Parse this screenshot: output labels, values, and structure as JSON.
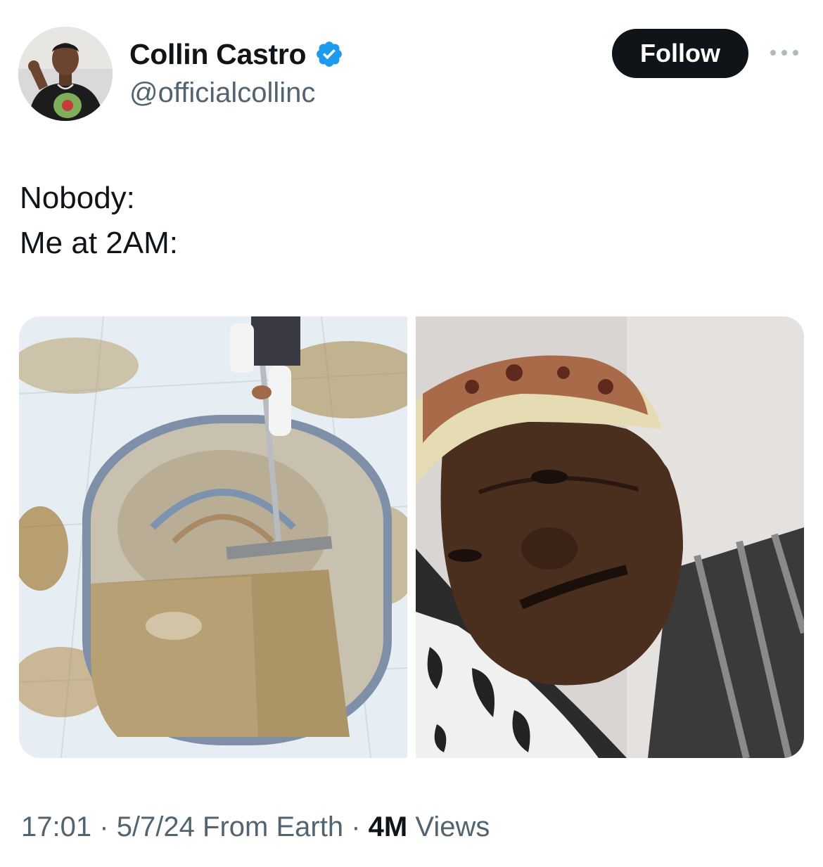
{
  "author": {
    "display_name": "Collin Castro",
    "handle": "@officialcollinc",
    "verified": true,
    "avatar_icon": "profile-photo"
  },
  "follow_label": "Follow",
  "more_icon": "more-options-icon",
  "tweet": {
    "lines": [
      "Nobody:",
      "Me at 2AM:"
    ]
  },
  "media": [
    {
      "icon": "photo-rug-cleaning"
    },
    {
      "icon": "photo-man-lying-down"
    }
  ],
  "meta": {
    "time": "17:01",
    "date": "5/7/24",
    "location": "From Earth",
    "views_count": "4M",
    "views_label": "Views",
    "separator": "·"
  },
  "colors": {
    "verified_blue": "#1d9bf0",
    "button_bg": "#0f1419",
    "secondary_text": "#536471"
  }
}
